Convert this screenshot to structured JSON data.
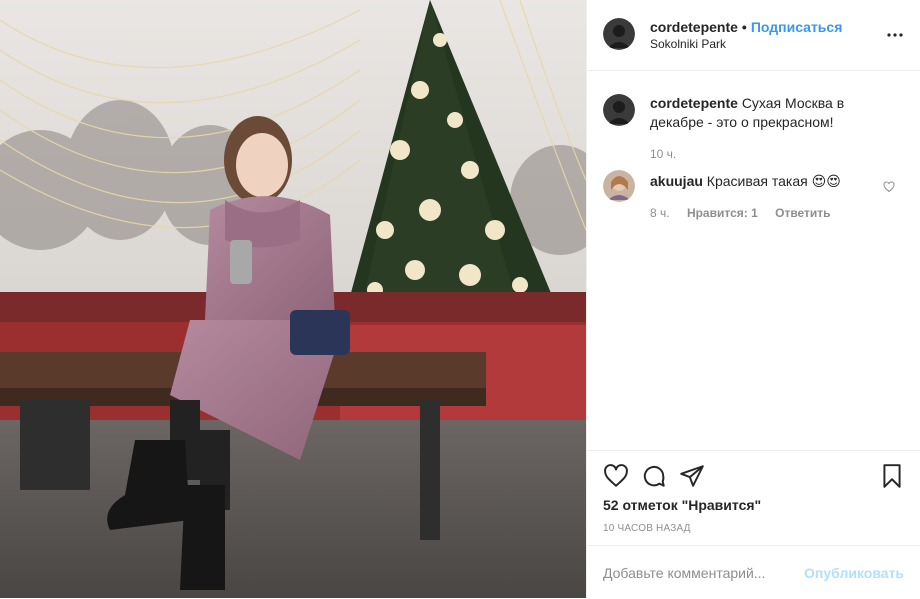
{
  "media": {
    "alt": "Photo"
  },
  "header": {
    "username": "cordetepente",
    "separator": "•",
    "follow_label": "Подписаться",
    "location": "Sokolniki Park",
    "more_icon": "more-horizontal-icon"
  },
  "caption": {
    "username": "cordetepente",
    "text": "Сухая Москва в декабре - это о прекрасном!",
    "age": "10 ч."
  },
  "comments": [
    {
      "username": "akuujau",
      "text": "Красивая такая 😍😍",
      "age": "8 ч.",
      "likes_label": "Нравится: 1",
      "reply_label": "Ответить"
    }
  ],
  "actions": {
    "like_icon": "heart-icon",
    "comment_icon": "comment-icon",
    "share_icon": "share-icon",
    "save_icon": "bookmark-icon",
    "likes_text": "52 отметок \"Нравится\"",
    "timestamp": "10 ЧАСОВ НАЗАД"
  },
  "add_comment": {
    "placeholder": "Добавьте комментарий...",
    "publish_label": "Опубликовать"
  },
  "colors": {
    "accent": "#3897f0",
    "publish_disabled": "#b2dffc",
    "muted": "#8e8e8e",
    "text": "#262626"
  }
}
